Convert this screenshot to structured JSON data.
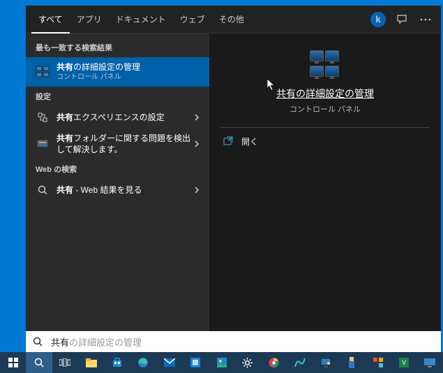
{
  "tabs": {
    "all": "すべて",
    "apps": "アプリ",
    "documents": "ドキュメント",
    "web": "ウェブ",
    "more": "その他"
  },
  "sections": {
    "best_match": "最も一致する検索結果",
    "settings": "設定",
    "web_search": "Web の検索"
  },
  "results": {
    "best": {
      "title_bold": "共有",
      "title_rest": "の詳細設定の管理",
      "subtitle": "コントロール パネル"
    },
    "settings_experience": {
      "bold": "共有",
      "rest": "エクスペリエンスの設定"
    },
    "settings_troubleshoot": {
      "bold": "共有",
      "rest": "フォルダーに関する問題を検出して解決します。"
    },
    "web_result": {
      "bold": "共有",
      "rest": " - Web 結果を見る"
    }
  },
  "preview": {
    "title": "共有の詳細設定の管理",
    "subtitle": "コントロール パネル",
    "open": "開く"
  },
  "search": {
    "typed": "共有",
    "completion": "の詳細設定の管理"
  }
}
